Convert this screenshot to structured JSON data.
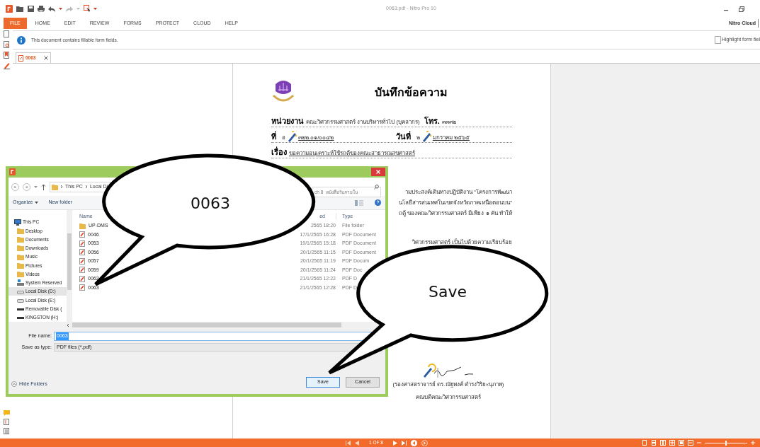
{
  "window": {
    "title": "0063.pdf - Nitro Pro 10"
  },
  "menu": [
    {
      "label": "FILE",
      "selected": true
    },
    {
      "label": "HOME",
      "selected": false
    },
    {
      "label": "EDIT",
      "selected": false
    },
    {
      "label": "REVIEW",
      "selected": false
    },
    {
      "label": "FORMS",
      "selected": false
    },
    {
      "label": "PROTECT",
      "selected": false
    },
    {
      "label": "CLOUD",
      "selected": false
    },
    {
      "label": "HELP",
      "selected": false
    }
  ],
  "account": "Nitro Cloud",
  "info_bar": {
    "message": "This document contains fillable form fields.",
    "checkbox": {
      "label": "Highlight form fiel",
      "checked": false
    }
  },
  "tabs": [
    {
      "label": "0063",
      "selected": true
    }
  ],
  "document": {
    "heading": "บันทึกข้อความ",
    "department": {
      "label": "หน่วยงาน",
      "value": "คณะวิศวกรรมศาสตร์  งานบริหารทั่วไป (บุคลากร)",
      "phone_label": "โทร.",
      "phone": "๓๓๓๒"
    },
    "reference": {
      "label": "ที่",
      "prefix": "อ",
      "value": "๓๒๒.๐๑/๐๐๔๒",
      "date_label": "วันที่",
      "date_prefix": "๒",
      "date": "มกราคม ๒๕๖๕"
    },
    "subject": {
      "label": "เรื่อง",
      "value": "ขอความอนุเคราะห์ใช้รถตู้ของคณะสาธารณสุขศาสตร์"
    },
    "body_lines": [
      "ามประสงค์เดินทางปฏิบัติงาน “โครงการพัฒนา",
      "นโลยีสารสนเทศในเขตจังหวัดภาคเหนือตอนบน”",
      "ถตู้ ของคณะวิศวกรรมศาสตร์ มีเพียง ๑ คัน ทำให้",
      "วิศวกรรมศาสตร์ เป็นไปด้วยความเรียบร้อย"
    ],
    "signature": {
      "name": "(รองศาสตราจารย์ ดร.ณัฐพงศ์  ดำรงวิริยะนุภาพ)",
      "position": "คณบดีคณะวิศวกรรมศาสตร์"
    }
  },
  "dialog": {
    "path": [
      "This PC",
      "Local Di"
    ],
    "search": {
      "placeholder": "ch 8  หนังสือรับภายใน"
    },
    "toolbar": [
      "Organize",
      "New folder"
    ],
    "nav": [
      {
        "label": "This PC",
        "kind": "computer",
        "selected": false
      },
      {
        "label": "Desktop",
        "kind": "folder",
        "selected": false
      },
      {
        "label": "Documents",
        "kind": "folder",
        "selected": false
      },
      {
        "label": "Downloads",
        "kind": "folder",
        "selected": false
      },
      {
        "label": "Music",
        "kind": "folder",
        "selected": false
      },
      {
        "label": "Pictures",
        "kind": "folder",
        "selected": false
      },
      {
        "label": "Videos",
        "kind": "folder",
        "selected": false
      },
      {
        "label": "System Reserved",
        "kind": "system",
        "selected": false
      },
      {
        "label": "Local Disk (D:)",
        "kind": "drive",
        "selected": true
      },
      {
        "label": "Local Disk (E:)",
        "kind": "drive",
        "selected": false
      },
      {
        "label": "Removable Disk (",
        "kind": "removable",
        "selected": false
      },
      {
        "label": "KINGSTON (H:)",
        "kind": "removable",
        "selected": false
      }
    ],
    "columns": [
      "Name",
      "ed",
      "Type"
    ],
    "rows": [
      {
        "name": "UP-DMS",
        "date": "2565 18:20",
        "type": "File folder",
        "kind": "folder"
      },
      {
        "name": "0046",
        "date": "17/1/2565 16:28",
        "type": "PDF Document",
        "kind": "pdf"
      },
      {
        "name": "0053",
        "date": "19/1/2565 15:18",
        "type": "PDF Document",
        "kind": "pdf"
      },
      {
        "name": "0056",
        "date": "20/1/2565 11:15",
        "type": "PDF Document",
        "kind": "pdf"
      },
      {
        "name": "0057",
        "date": "20/1/2565 11:19",
        "type": "PDF Docum",
        "kind": "pdf"
      },
      {
        "name": "0059",
        "date": "20/1/2565 11:24",
        "type": "PDF Doc",
        "kind": "pdf"
      },
      {
        "name": "0062",
        "date": "21/1/2565 12:22",
        "type": "PDF D",
        "kind": "pdf"
      },
      {
        "name": "0063",
        "date": "21/1/2565 12:28",
        "type": "PDF D",
        "kind": "pdf"
      }
    ],
    "file_name": {
      "label": "File name:",
      "value": "0063"
    },
    "save_type": {
      "label": "Save as type:",
      "value": "PDF files (*.pdf)"
    },
    "hide_folders": "Hide Folders",
    "buttons": [
      "Save",
      "Cancel"
    ]
  },
  "callouts": [
    {
      "text": "0063"
    },
    {
      "text": "Save"
    }
  ],
  "status_bar": {
    "page": "1 OF 8",
    "zoom": {
      "level": 0.5
    }
  }
}
